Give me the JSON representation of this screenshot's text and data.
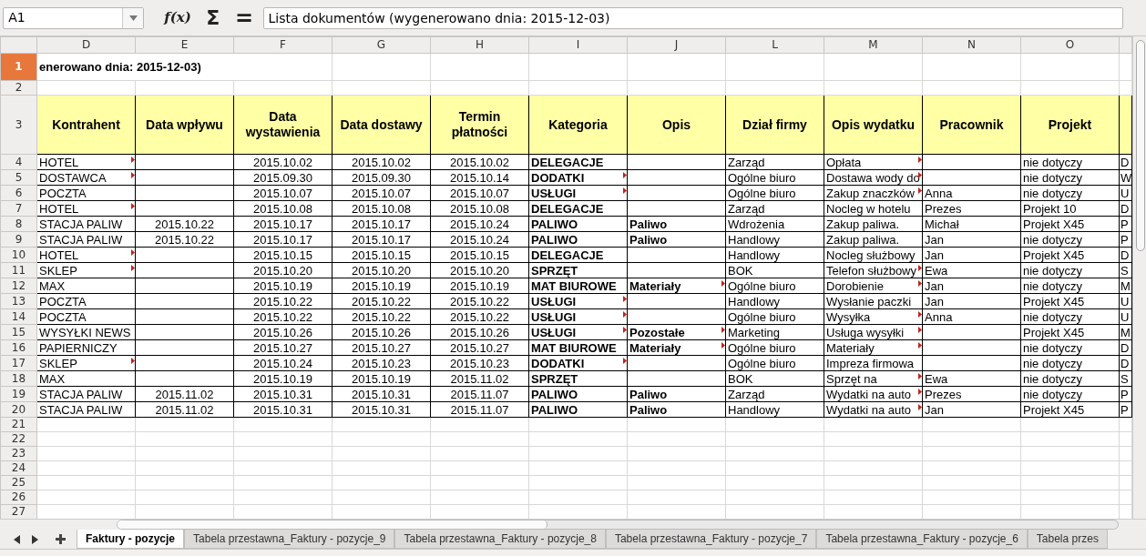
{
  "toolbar": {
    "name_box": "A1",
    "function_wizard": "f(x)",
    "sum": "Σ",
    "formula": "=",
    "formula_value": "Lista dokumentów (wygenerowano dnia: 2015-12-03)"
  },
  "columns": [
    "D",
    "E",
    "F",
    "G",
    "H",
    "I",
    "J",
    "L",
    "M",
    "N",
    "O"
  ],
  "rows": [
    {
      "number": "1",
      "selected": true,
      "kind": "title",
      "cells": [
        "enerowano dnia: 2015-12-03)"
      ]
    },
    {
      "number": "2",
      "selected": false,
      "kind": "empty"
    },
    {
      "number": "3",
      "selected": false,
      "kind": "header",
      "cells": [
        "Kontrahent",
        "Data wpływu",
        "Data wystawienia",
        "Data dostawy",
        "Termin płatności",
        "Kategoria",
        "Opis",
        "Dział firmy",
        "Opis wydatku",
        "Pracownik",
        "Projekt"
      ]
    },
    {
      "number": "4",
      "selected": false,
      "kind": "data",
      "cells": [
        "HOTEL",
        "",
        "2015.10.02",
        "2015.10.02",
        "2015.10.02",
        "DELEGACJE",
        "",
        "Zarząd",
        "Opłata",
        "",
        "nie dotyczy",
        "D"
      ],
      "comments": [
        true,
        false,
        false,
        false,
        false,
        false,
        false,
        false,
        true,
        false,
        false,
        false
      ]
    },
    {
      "number": "5",
      "selected": false,
      "kind": "data",
      "cells": [
        "DOSTAWCA",
        "",
        "2015.09.30",
        "2015.09.30",
        "2015.10.14",
        "DODATKI",
        "",
        "Ogólne biuro",
        "Dostawa wody do",
        "",
        "nie dotyczy",
        "W"
      ],
      "comments": [
        true,
        false,
        false,
        false,
        false,
        true,
        false,
        false,
        true,
        false,
        false,
        false
      ]
    },
    {
      "number": "6",
      "selected": false,
      "kind": "data",
      "cells": [
        "POCZTA",
        "",
        "2015.10.07",
        "2015.10.07",
        "2015.10.07",
        "USŁUGI",
        "",
        "Ogólne biuro",
        "Zakup znaczków",
        "Anna",
        "nie dotyczy",
        "U"
      ],
      "comments": [
        false,
        false,
        false,
        false,
        false,
        true,
        false,
        false,
        true,
        false,
        false,
        false
      ]
    },
    {
      "number": "7",
      "selected": false,
      "kind": "data",
      "cells": [
        "HOTEL",
        "",
        "2015.10.08",
        "2015.10.08",
        "2015.10.08",
        "DELEGACJE",
        "",
        "Zarząd",
        "Nocleg w hotelu",
        "Prezes",
        "Projekt 10",
        "D"
      ],
      "comments": [
        true,
        false,
        false,
        false,
        false,
        false,
        false,
        false,
        false,
        false,
        false,
        false
      ]
    },
    {
      "number": "8",
      "selected": false,
      "kind": "data",
      "cells": [
        "STACJA PALIW",
        "2015.10.22",
        "2015.10.17",
        "2015.10.17",
        "2015.10.24",
        "PALIWO",
        "Paliwo",
        "Wdrożenia",
        "Zakup paliwa.",
        "Michał",
        "Projekt X45",
        "P"
      ],
      "comments": [
        false,
        false,
        false,
        false,
        false,
        false,
        false,
        false,
        false,
        false,
        false,
        false
      ]
    },
    {
      "number": "9",
      "selected": false,
      "kind": "data",
      "cells": [
        "STACJA PALIW",
        "2015.10.22",
        "2015.10.17",
        "2015.10.17",
        "2015.10.24",
        "PALIWO",
        "Paliwo",
        "Handlowy",
        "Zakup paliwa.",
        "Jan",
        "nie dotyczy",
        "P"
      ],
      "comments": [
        false,
        false,
        false,
        false,
        false,
        false,
        false,
        false,
        false,
        false,
        false,
        false
      ]
    },
    {
      "number": "10",
      "selected": false,
      "kind": "data",
      "cells": [
        "HOTEL",
        "",
        "2015.10.15",
        "2015.10.15",
        "2015.10.15",
        "DELEGACJE",
        "",
        "Handlowy",
        "Nocleg służbowy",
        "Jan",
        "Projekt X45",
        "D"
      ],
      "comments": [
        true,
        false,
        false,
        false,
        false,
        false,
        false,
        false,
        false,
        false,
        false,
        false
      ]
    },
    {
      "number": "11",
      "selected": false,
      "kind": "data",
      "cells": [
        "SKLEP",
        "",
        "2015.10.20",
        "2015.10.20",
        "2015.10.20",
        "SPRZĘT",
        "",
        "BOK",
        "Telefon służbowy",
        "Ewa",
        "nie dotyczy",
        "S"
      ],
      "comments": [
        true,
        false,
        false,
        false,
        false,
        false,
        false,
        false,
        true,
        false,
        false,
        false
      ]
    },
    {
      "number": "12",
      "selected": false,
      "kind": "data",
      "cells": [
        "MAX",
        "",
        "2015.10.19",
        "2015.10.19",
        "2015.10.19",
        "MAT BIUROWE",
        "Materiały",
        "Ogólne biuro",
        "Dorobienie",
        "Jan",
        "nie dotyczy",
        "M"
      ],
      "comments": [
        false,
        false,
        false,
        false,
        false,
        false,
        true,
        false,
        true,
        false,
        false,
        false
      ]
    },
    {
      "number": "13",
      "selected": false,
      "kind": "data",
      "cells": [
        "POCZTA",
        "",
        "2015.10.22",
        "2015.10.22",
        "2015.10.22",
        "USŁUGI",
        "",
        "Handlowy",
        "Wysłanie paczki",
        "Jan",
        "Projekt X45",
        "U"
      ],
      "comments": [
        false,
        false,
        false,
        false,
        false,
        true,
        false,
        false,
        false,
        false,
        false,
        false
      ]
    },
    {
      "number": "14",
      "selected": false,
      "kind": "data",
      "cells": [
        "POCZTA",
        "",
        "2015.10.22",
        "2015.10.22",
        "2015.10.22",
        "USŁUGI",
        "",
        "Ogólne biuro",
        "Wysyłka",
        "Anna",
        "nie dotyczy",
        "U"
      ],
      "comments": [
        false,
        false,
        false,
        false,
        false,
        true,
        false,
        false,
        true,
        false,
        false,
        false
      ]
    },
    {
      "number": "15",
      "selected": false,
      "kind": "data",
      "cells": [
        "WYSYŁKI NEWS",
        "",
        "2015.10.26",
        "2015.10.26",
        "2015.10.26",
        "USŁUGI",
        "Pozostałe",
        "Marketing",
        "Usługa wysyłki",
        "",
        "Projekt X45",
        "M"
      ],
      "comments": [
        false,
        false,
        false,
        false,
        false,
        true,
        true,
        false,
        true,
        false,
        false,
        false
      ]
    },
    {
      "number": "16",
      "selected": false,
      "kind": "data",
      "cells": [
        "PAPIERNICZY",
        "",
        "2015.10.27",
        "2015.10.27",
        "2015.10.27",
        "MAT BIUROWE",
        "Materiały",
        "Ogólne biuro",
        "Materiały",
        "",
        "nie dotyczy",
        "D"
      ],
      "comments": [
        false,
        false,
        false,
        false,
        false,
        false,
        true,
        false,
        true,
        false,
        false,
        false
      ]
    },
    {
      "number": "17",
      "selected": false,
      "kind": "data",
      "cells": [
        "SKLEP",
        "",
        "2015.10.24",
        "2015.10.23",
        "2015.10.23",
        "DODATKI",
        "",
        "Ogólne biuro",
        "Impreza firmowa",
        "",
        "nie dotyczy",
        "D"
      ],
      "comments": [
        true,
        false,
        false,
        false,
        false,
        true,
        false,
        false,
        false,
        false,
        false,
        false
      ]
    },
    {
      "number": "18",
      "selected": false,
      "kind": "data",
      "cells": [
        "MAX",
        "",
        "2015.10.19",
        "2015.10.19",
        "2015.11.02",
        "SPRZĘT",
        "",
        "BOK",
        "Sprzęt na",
        "Ewa",
        "nie dotyczy",
        "S"
      ],
      "comments": [
        false,
        false,
        false,
        false,
        false,
        false,
        false,
        false,
        true,
        false,
        false,
        false
      ]
    },
    {
      "number": "19",
      "selected": false,
      "kind": "data",
      "cells": [
        "STACJA PALIW",
        "2015.11.02",
        "2015.10.31",
        "2015.10.31",
        "2015.11.07",
        "PALIWO",
        "Paliwo",
        "Zarząd",
        "Wydatki na auto",
        "Prezes",
        "nie dotyczy",
        "P"
      ],
      "comments": [
        false,
        false,
        false,
        false,
        false,
        false,
        false,
        false,
        true,
        false,
        false,
        false
      ]
    },
    {
      "number": "20",
      "selected": false,
      "kind": "data",
      "cells": [
        "STACJA PALIW",
        "2015.11.02",
        "2015.10.31",
        "2015.10.31",
        "2015.11.07",
        "PALIWO",
        "Paliwo",
        "Handlowy",
        "Wydatki na auto",
        "Jan",
        "Projekt X45",
        "P"
      ],
      "comments": [
        false,
        false,
        false,
        false,
        false,
        false,
        false,
        false,
        true,
        false,
        false,
        false
      ]
    },
    {
      "number": "21",
      "selected": false,
      "kind": "empty"
    },
    {
      "number": "22",
      "selected": false,
      "kind": "empty"
    },
    {
      "number": "23",
      "selected": false,
      "kind": "empty"
    },
    {
      "number": "24",
      "selected": false,
      "kind": "empty"
    },
    {
      "number": "25",
      "selected": false,
      "kind": "empty"
    },
    {
      "number": "26",
      "selected": false,
      "kind": "empty"
    },
    {
      "number": "27",
      "selected": false,
      "kind": "empty"
    }
  ],
  "sheet_tabs": [
    {
      "label": "Faktury - pozycje",
      "selected": true
    },
    {
      "label": "Tabela przestawna_Faktury - pozycje_9",
      "selected": false
    },
    {
      "label": "Tabela przestawna_Faktury - pozycje_8",
      "selected": false
    },
    {
      "label": "Tabela przestawna_Faktury - pozycje_7",
      "selected": false
    },
    {
      "label": "Tabela przestawna_Faktury - pozycje_6",
      "selected": false
    },
    {
      "label": "Tabela przes",
      "selected": false
    }
  ]
}
